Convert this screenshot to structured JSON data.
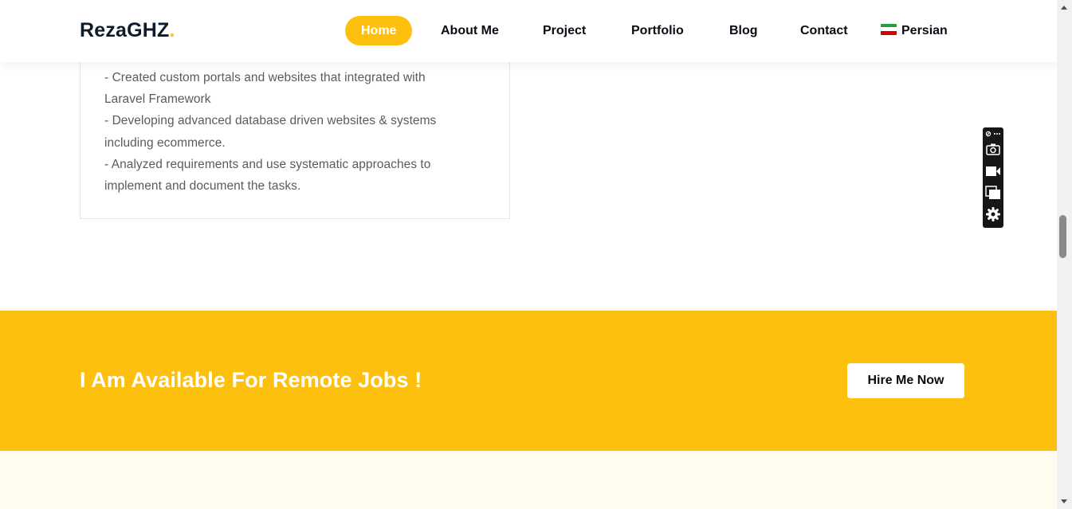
{
  "header": {
    "logo_text": "RezaGHZ",
    "logo_dot": ".",
    "nav": [
      {
        "label": "Home",
        "active": true
      },
      {
        "label": "About Me"
      },
      {
        "label": "Project"
      },
      {
        "label": "Portfolio"
      },
      {
        "label": "Blog"
      },
      {
        "label": "Contact"
      },
      {
        "label": "Persian",
        "icon": "iran-flag-icon"
      }
    ]
  },
  "experience": {
    "lines": [
      "- Created custom portals and websites that integrated with",
      "Laravel Framework",
      "- Developing advanced database driven websites & systems",
      "including ecommerce.",
      "- Analyzed requirements and use systematic approaches to",
      "implement and document the tasks."
    ]
  },
  "hire": {
    "title": "I Am Available For Remote Jobs !",
    "button": "Hire Me Now"
  },
  "toolbar": {
    "icons": [
      "link-icon",
      "more-icon",
      "camera-icon",
      "video-icon",
      "copy-window-icon",
      "gear-icon"
    ]
  },
  "colors": {
    "accent": "#fec00f",
    "text_dark": "#0b0b13",
    "text_muted": "#5a5a62",
    "section_bg": "#fffbee"
  }
}
